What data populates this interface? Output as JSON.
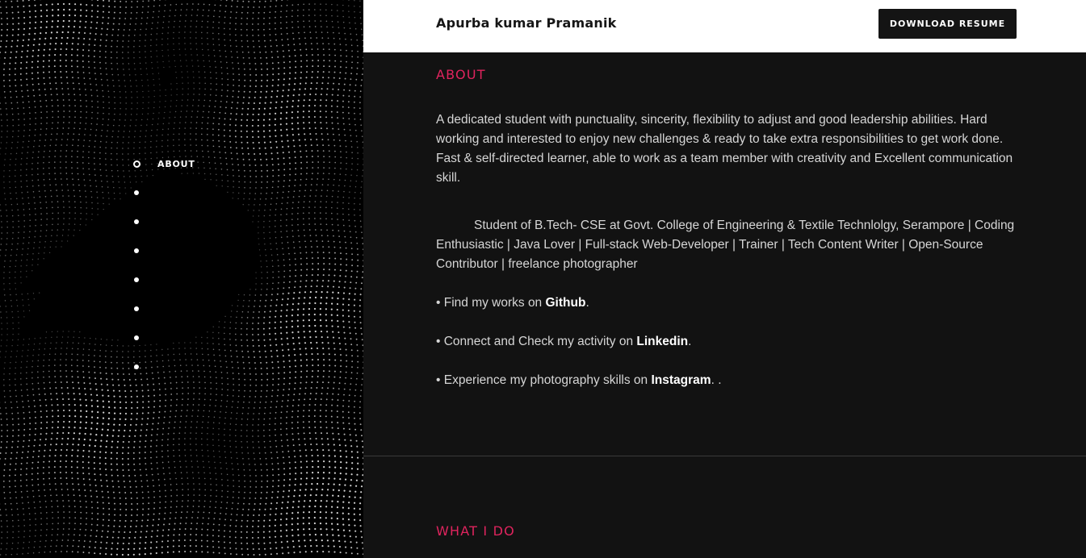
{
  "header": {
    "name": "Apurba kumar Pramanik",
    "resume_button": "DOWNLOAD RESUME"
  },
  "nav": {
    "items": [
      {
        "label": "ABOUT",
        "active": true
      },
      {
        "label": "",
        "active": false
      },
      {
        "label": "",
        "active": false
      },
      {
        "label": "",
        "active": false
      },
      {
        "label": "",
        "active": false
      },
      {
        "label": "",
        "active": false
      },
      {
        "label": "",
        "active": false
      },
      {
        "label": "",
        "active": false
      }
    ]
  },
  "about": {
    "title": "ABOUT",
    "paragraph1": "A dedicated student with punctuality, sincerity, flexibility to adjust and good leadership abilities. Hard working and interested to enjoy new challenges & ready to take extra responsibilities to get work done. Fast & self-directed learner, able to work as a team member with creativity and Excellent communication skill.",
    "paragraph2": "Student of B.Tech- CSE at Govt. College of Engineering & Textile Technlolgy, Serampore | Coding Enthusiastic | Java Lover | Full-stack Web-Developer | Trainer | Tech Content Writer | Open-Source Contributor | freelance photographer",
    "github": {
      "prefix": "• Find my works on ",
      "link": "Github",
      "suffix": "."
    },
    "linkedin": {
      "prefix": "• Connect and Check my activity on ",
      "link": "Linkedin",
      "suffix": "."
    },
    "instagram": {
      "prefix": "• Experience my photography skills on ",
      "link": "Instagram",
      "suffix": ". ."
    }
  },
  "what_i_do": {
    "title": "WHAT I DO"
  },
  "colors": {
    "accent": "#e0245e",
    "main_bg": "#121212",
    "left_bg": "#000000",
    "header_bg": "#ffffff"
  }
}
